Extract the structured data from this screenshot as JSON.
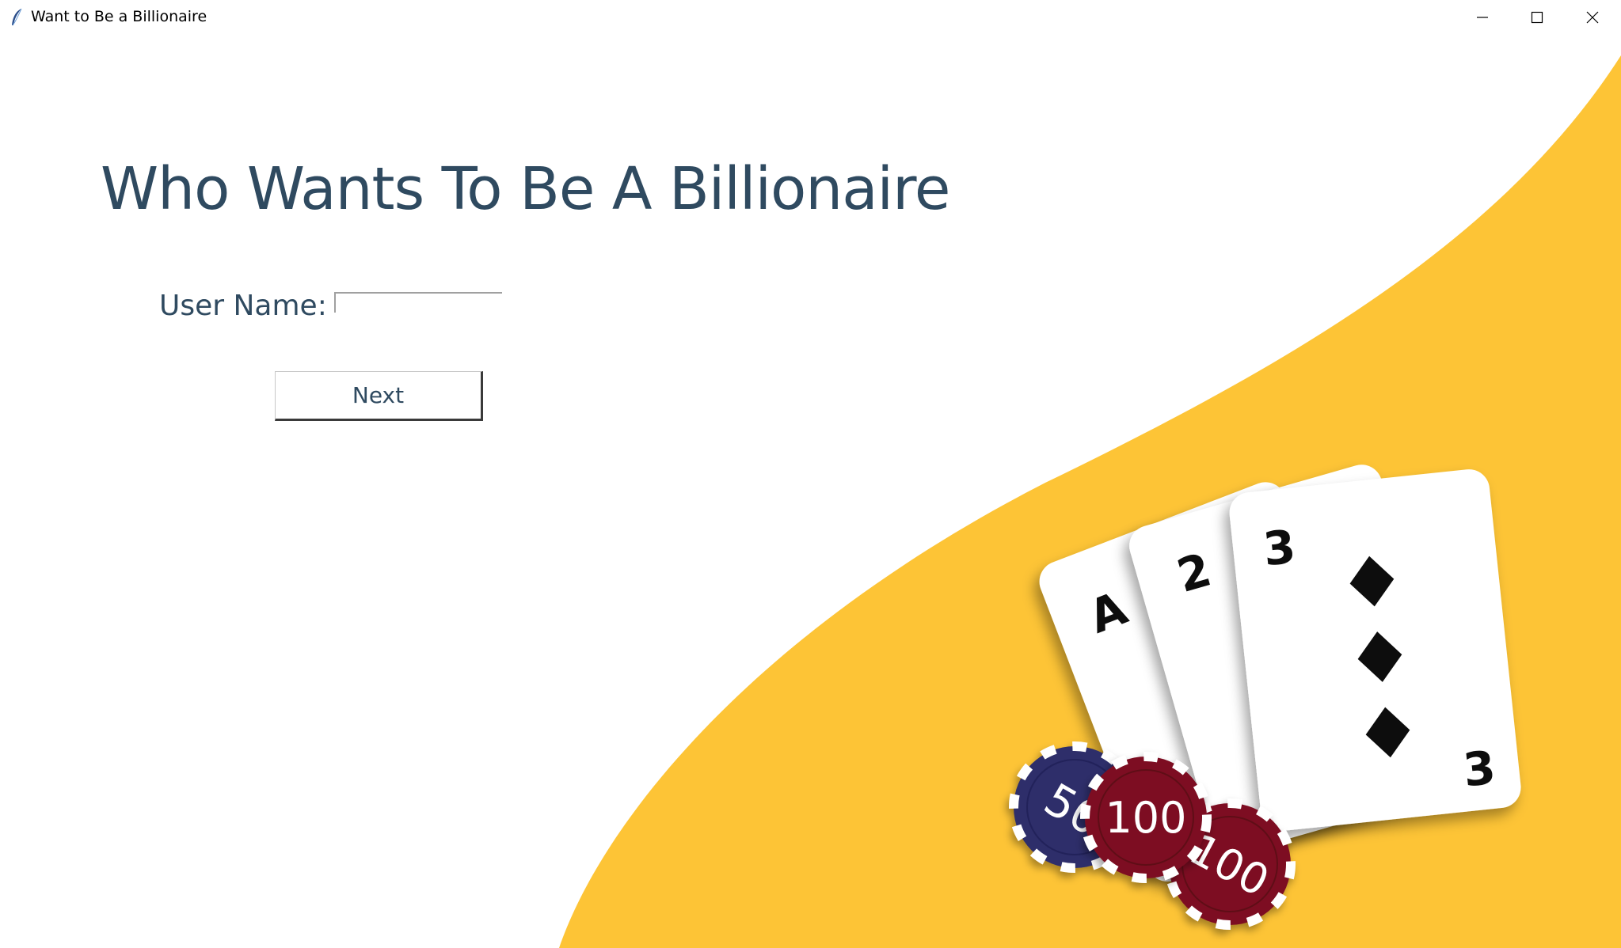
{
  "window": {
    "title": "Want to Be a Billionaire",
    "controls": [
      "minimize",
      "maximize",
      "close"
    ]
  },
  "main": {
    "heading": "Who Wants To Be A Billionaire",
    "username_label": "User Name:",
    "username_value": "",
    "next_label": "Next"
  },
  "artwork": {
    "cards": [
      {
        "rank": "A",
        "icon": "card-ace-icon"
      },
      {
        "rank": "2",
        "icon": "card-two-icon"
      },
      {
        "rank": "3",
        "icon": "card-three-of-diamonds-icon"
      }
    ],
    "chips": [
      {
        "value": "50",
        "color": "#2d2d6b"
      },
      {
        "value": "100",
        "color": "#7d0f22"
      },
      {
        "value": "100",
        "color": "#7d0f22"
      }
    ]
  },
  "colors": {
    "accent_yellow": "#fdc436",
    "heading_text": "#2f4a60"
  }
}
